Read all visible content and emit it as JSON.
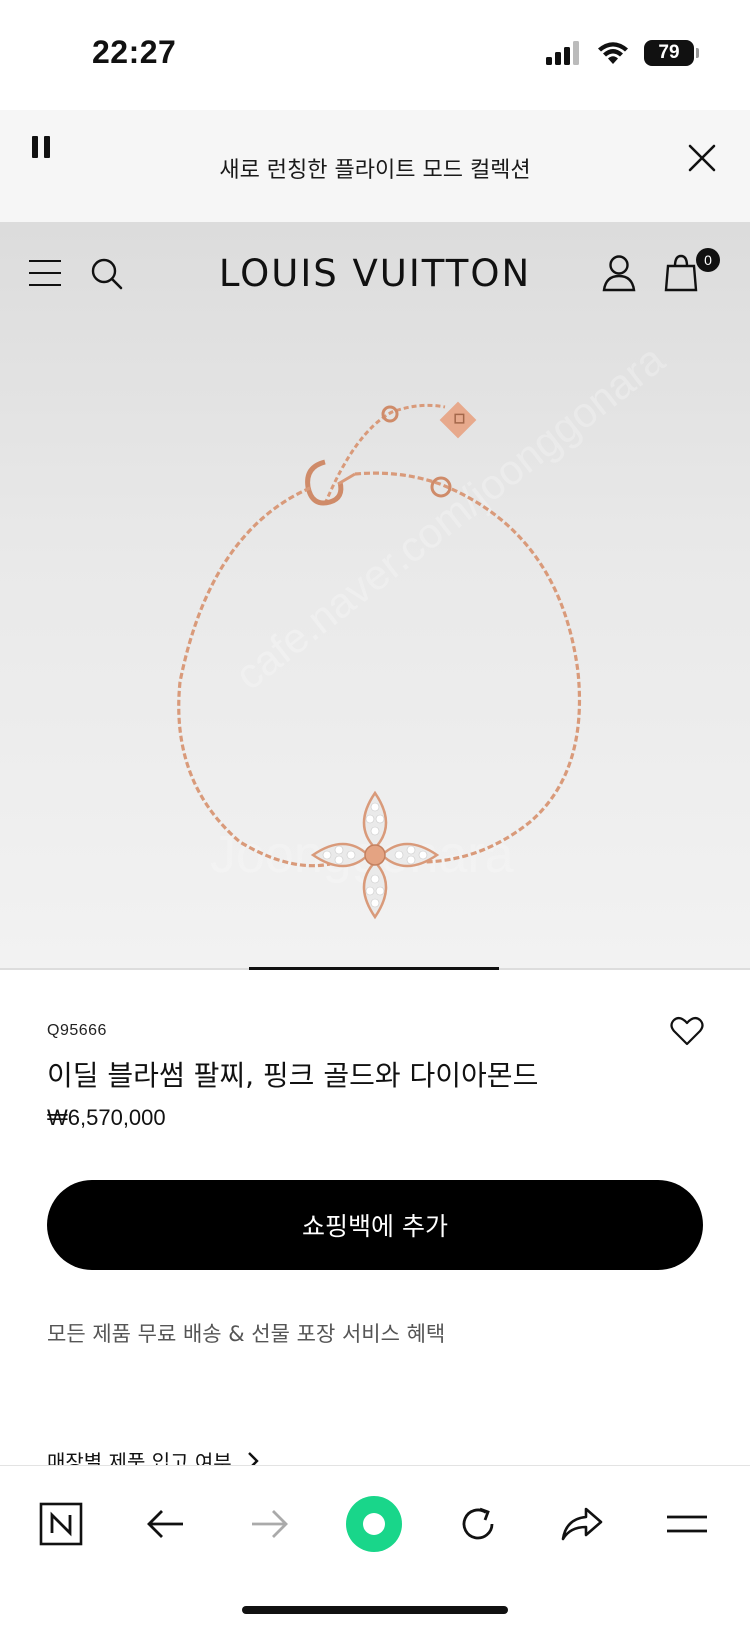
{
  "status_bar": {
    "time": "22:27",
    "battery": "79"
  },
  "announcement": {
    "text": "새로 런칭한 플라이트 모드 컬렉션"
  },
  "header": {
    "brand": "LOUIS VUITTON",
    "cart_count": "0"
  },
  "product": {
    "sku": "Q95666",
    "name": "이딜 블라썸 팔찌, 핑크 골드와 다이아몬드",
    "price": "₩6,570,000",
    "add_to_bag_label": "쇼핑백에 추가",
    "service_text": "모든 제품 무료 배송 & 선물 포장 서비스 혜택",
    "stock_link_label": "매장별 제품 입고 여부"
  },
  "colors": {
    "accent": "#000000",
    "chain": "#d99a7a",
    "background": "#e6e6e6"
  },
  "icons": [
    "pause-icon",
    "close-icon",
    "menu-icon",
    "search-icon",
    "user-icon",
    "shopping-bag-icon",
    "heart-icon",
    "chevron-right-icon",
    "naver-n-icon",
    "back-arrow-icon",
    "forward-arrow-icon",
    "green-dot-icon",
    "reload-icon",
    "share-icon",
    "hamburger-icon"
  ]
}
